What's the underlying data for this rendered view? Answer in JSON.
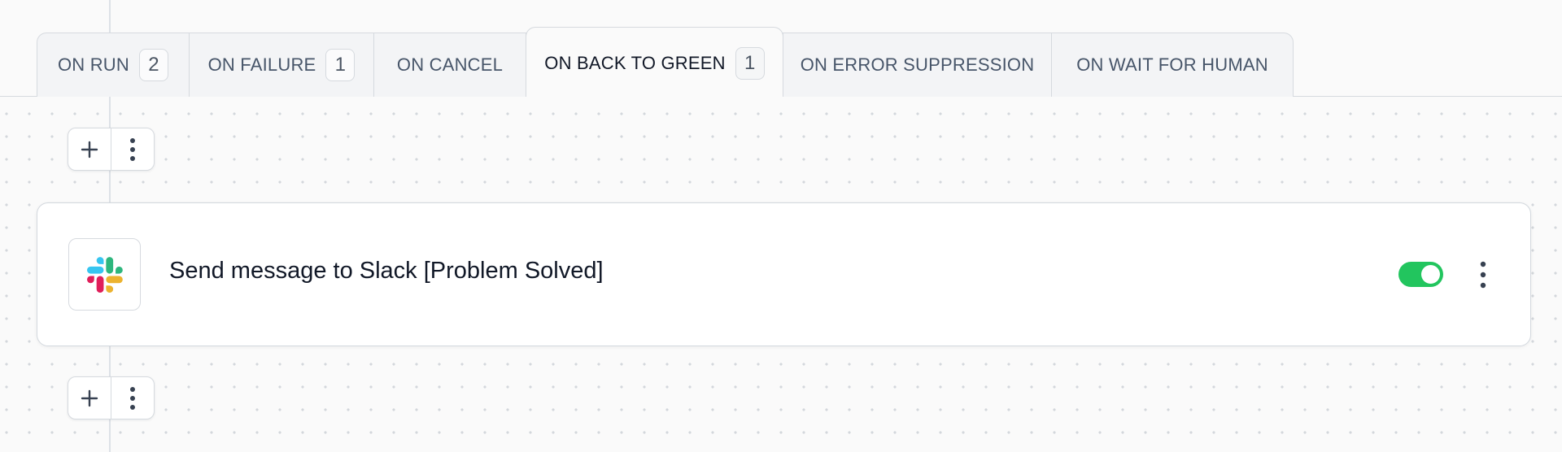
{
  "tabs": [
    {
      "label": "ON RUN",
      "count": "2"
    },
    {
      "label": "ON FAILURE",
      "count": "1"
    },
    {
      "label": "ON CANCEL"
    },
    {
      "label": "ON BACK TO GREEN",
      "count": "1",
      "active": true
    },
    {
      "label": "ON ERROR SUPPRESSION"
    },
    {
      "label": "ON WAIT FOR HUMAN"
    }
  ],
  "controls": {
    "add_icon": "plus-icon",
    "menu_icon": "vertical-dots-icon"
  },
  "step": {
    "title": "Send message to Slack [Problem Solved]",
    "icon": "slack-logo-icon",
    "enabled": true
  },
  "colors": {
    "toggle_on": "#22c55e",
    "slack_blue": "#36C5F0",
    "slack_green": "#2EB67D",
    "slack_yellow": "#ECB22E",
    "slack_red": "#E01E5A"
  }
}
